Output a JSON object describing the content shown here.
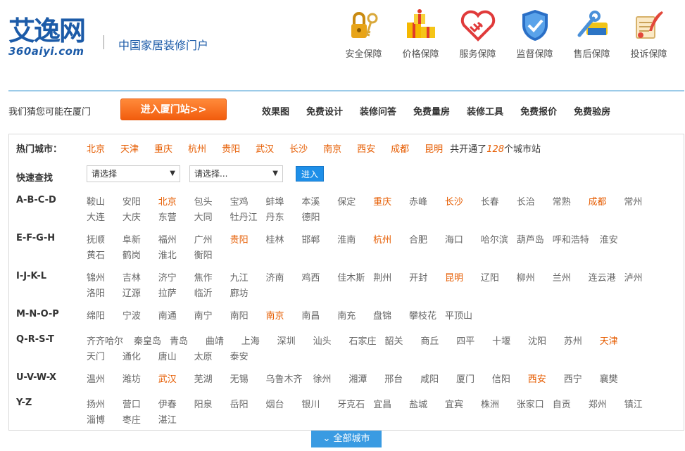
{
  "logo": {
    "main": "艾逸网",
    "sub": "360aiyi.com"
  },
  "slogan": "中国家居装修门户",
  "guarantees": [
    {
      "label": "安全保障",
      "icon": "lock-key-icon"
    },
    {
      "label": "价格保障",
      "icon": "gift-boxes-icon"
    },
    {
      "label": "服务保障",
      "icon": "handshake-heart-icon"
    },
    {
      "label": "监督保障",
      "icon": "shield-check-icon"
    },
    {
      "label": "售后保障",
      "icon": "wrench-tool-icon"
    },
    {
      "label": "投诉保障",
      "icon": "scroll-quill-icon"
    }
  ],
  "nav": {
    "guess": "我们猜您可能在厦门",
    "enter_station": "进入厦门站>>",
    "links": [
      "效果图",
      "免费设计",
      "装修问答",
      "免费量房",
      "装修工具",
      "免费报价",
      "免费验房"
    ]
  },
  "hot": {
    "label": "热门城市：",
    "cities": [
      "北京",
      "天津",
      "重庆",
      "杭州",
      "贵阳",
      "武汉",
      "长沙",
      "南京",
      "西安",
      "成都",
      "昆明"
    ],
    "total_prefix": "共开通了",
    "total_num": "128",
    "total_suffix": "个城市站"
  },
  "quick": {
    "label": "快速查找",
    "select1": "请选择",
    "select2": "请选择...",
    "go": "进入"
  },
  "groups": [
    {
      "label": "A-B-C-D",
      "rows": [
        [
          "鞍山",
          "安阳",
          "北京",
          "包头",
          "宝鸡",
          "蚌埠",
          "本溪",
          "保定",
          "重庆",
          "赤峰",
          "长沙",
          "长春",
          "长治",
          "常熟",
          "成都",
          "常州"
        ],
        [
          "大连",
          "大庆",
          "东营",
          "大同",
          "牡丹江",
          "丹东",
          "德阳"
        ]
      ],
      "hot": [
        "北京",
        "重庆",
        "长沙",
        "成都"
      ]
    },
    {
      "label": "E-F-G-H",
      "rows": [
        [
          "抚顺",
          "阜新",
          "福州",
          "广州",
          "贵阳",
          "桂林",
          "邯郸",
          "淮南",
          "杭州",
          "合肥",
          "海口",
          "哈尔滨",
          "葫芦岛",
          "呼和浩特",
          "淮安"
        ],
        [
          "黄石",
          "鹤岗",
          "淮北",
          "衡阳"
        ]
      ],
      "hot": [
        "贵阳",
        "杭州"
      ]
    },
    {
      "label": "I-J-K-L",
      "rows": [
        [
          "锦州",
          "吉林",
          "济宁",
          "焦作",
          "九江",
          "济南",
          "鸡西",
          "佳木斯",
          "荆州",
          "开封",
          "昆明",
          "辽阳",
          "柳州",
          "兰州",
          "连云港",
          "泸州"
        ],
        [
          "洛阳",
          "辽源",
          "拉萨",
          "临沂",
          "廊坊"
        ]
      ],
      "hot": [
        "昆明"
      ]
    },
    {
      "label": "M-N-O-P",
      "rows": [
        [
          "绵阳",
          "宁波",
          "南通",
          "南宁",
          "南阳",
          "南京",
          "南昌",
          "南充",
          "盘锦",
          "攀枝花",
          "平顶山"
        ]
      ],
      "hot": [
        "南京"
      ]
    },
    {
      "label": "Q-R-S-T",
      "rows": [
        [
          "齐齐哈尔",
          "秦皇岛",
          "青岛",
          "曲靖",
          "上海",
          "深圳",
          "汕头",
          "石家庄",
          "韶关",
          "商丘",
          "四平",
          "十堰",
          "沈阳",
          "苏州",
          "天津"
        ],
        [
          "天门",
          "通化",
          "唐山",
          "太原",
          "泰安"
        ]
      ],
      "hot": [
        "天津"
      ]
    },
    {
      "label": "U-V-W-X",
      "rows": [
        [
          "温州",
          "潍坊",
          "武汉",
          "芜湖",
          "无锡",
          "乌鲁木齐",
          "徐州",
          "湘潭",
          "邢台",
          "咸阳",
          "厦门",
          "信阳",
          "西安",
          "西宁",
          "襄樊"
        ]
      ],
      "hot": [
        "武汉",
        "西安"
      ]
    },
    {
      "label": "Y-Z",
      "rows": [
        [
          "扬州",
          "营口",
          "伊春",
          "阳泉",
          "岳阳",
          "烟台",
          "银川",
          "牙克石",
          "宜昌",
          "盐城",
          "宜宾",
          "株洲",
          "张家口",
          "自贡",
          "郑州",
          "镇江"
        ],
        [
          "淄博",
          "枣庄",
          "湛江"
        ]
      ],
      "hot": []
    }
  ],
  "all_cities": "全部城市",
  "colors": {
    "brand": "#1c5ba8",
    "hot": "#e65c00",
    "button_orange": "#f25d0e",
    "button_blue": "#1e8fe8"
  }
}
